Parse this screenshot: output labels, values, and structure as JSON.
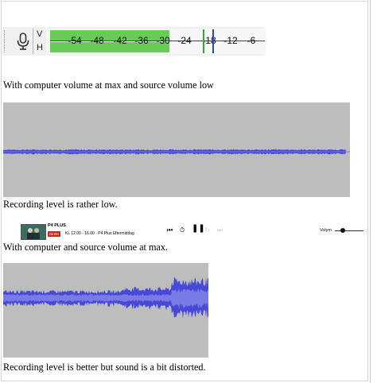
{
  "meter": {
    "channel_top": "V",
    "channel_bottom": "H",
    "scale": [
      "-54",
      "-48",
      "-42",
      "-36",
      "-30",
      "-24",
      "-18",
      "-12",
      "-6"
    ],
    "fill_color": "#66cc55",
    "icons": [
      "microphone-icon"
    ]
  },
  "captions": {
    "first": "With computer volume at max and source volume low",
    "second": "Recording level is rather low.",
    "third": "With computer and source volume at max.",
    "fourth": "Recording level is better but sound is a bit distorted."
  },
  "waveform_colors": {
    "background": "#bdbdbd",
    "wave": "#4747d8",
    "light": "#7a7ae6"
  },
  "player": {
    "channel": "P4 PLUS",
    "live_badge": "Direkt",
    "program": "KL 12.00 - 16.00 · P4 Plus Eftermiddag",
    "volume_label": "Volym",
    "volume_level": 0.2,
    "icons": [
      "skip-back-icon",
      "timer-icon",
      "pause-icon",
      "replay-icon",
      "skip-forward-icon"
    ]
  }
}
